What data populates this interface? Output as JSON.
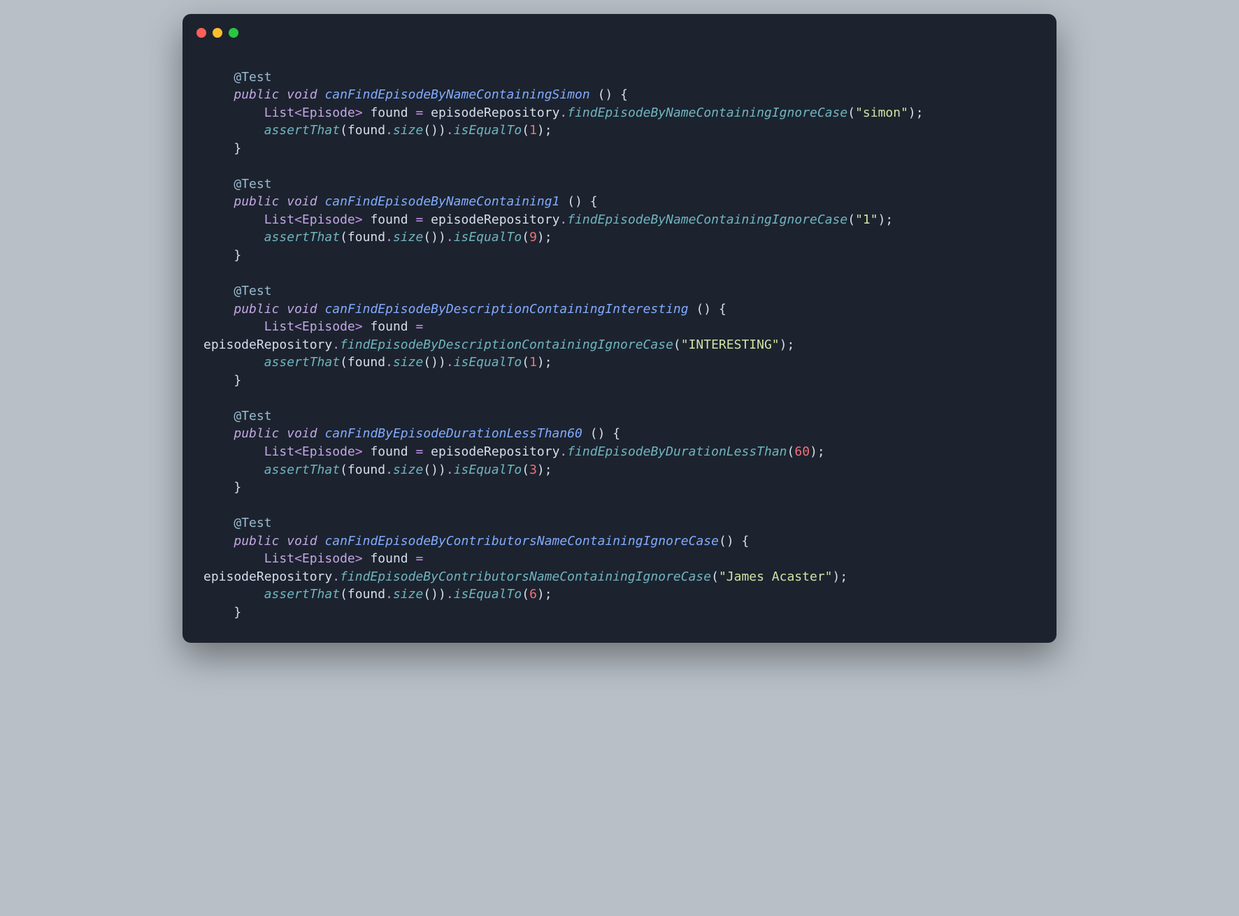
{
  "annotation": "@Test",
  "kw_public": "public",
  "kw_void": "void",
  "type_list": "List",
  "type_ep": "Episode",
  "var_found": "found",
  "repo": "episodeRepository",
  "assertThat": "assertThat",
  "size": "size",
  "isEqualTo": "isEqualTo",
  "tests": [
    {
      "name": "canFindEpisodeByNameContainingSimon",
      "spaceBeforeParens": true,
      "call": "findEpisodeByNameContainingIgnoreCase",
      "argStr": "\"simon\"",
      "expect": "1",
      "wrap": false
    },
    {
      "name": "canFindEpisodeByNameContaining1",
      "spaceBeforeParens": true,
      "call": "findEpisodeByNameContainingIgnoreCase",
      "argStr": "\"1\"",
      "expect": "9",
      "wrap": false
    },
    {
      "name": "canFindEpisodeByDescriptionContainingInteresting",
      "spaceBeforeParens": true,
      "call": "findEpisodeByDescriptionContainingIgnoreCase",
      "argStr": "\"INTERESTING\"",
      "expect": "1",
      "wrap": true
    },
    {
      "name": "canFindByEpisodeDurationLessThan60",
      "spaceBeforeParens": true,
      "call": "findEpisodeByDurationLessThan",
      "argNum": "60",
      "expect": "3",
      "wrap": false
    },
    {
      "name": "canFindEpisodeByContributorsNameContainingIgnoreCase",
      "spaceBeforeParens": false,
      "call": "findEpisodeByContributorsNameContainingIgnoreCase",
      "argStr": "\"James Acaster\"",
      "expect": "6",
      "wrap": true
    }
  ]
}
